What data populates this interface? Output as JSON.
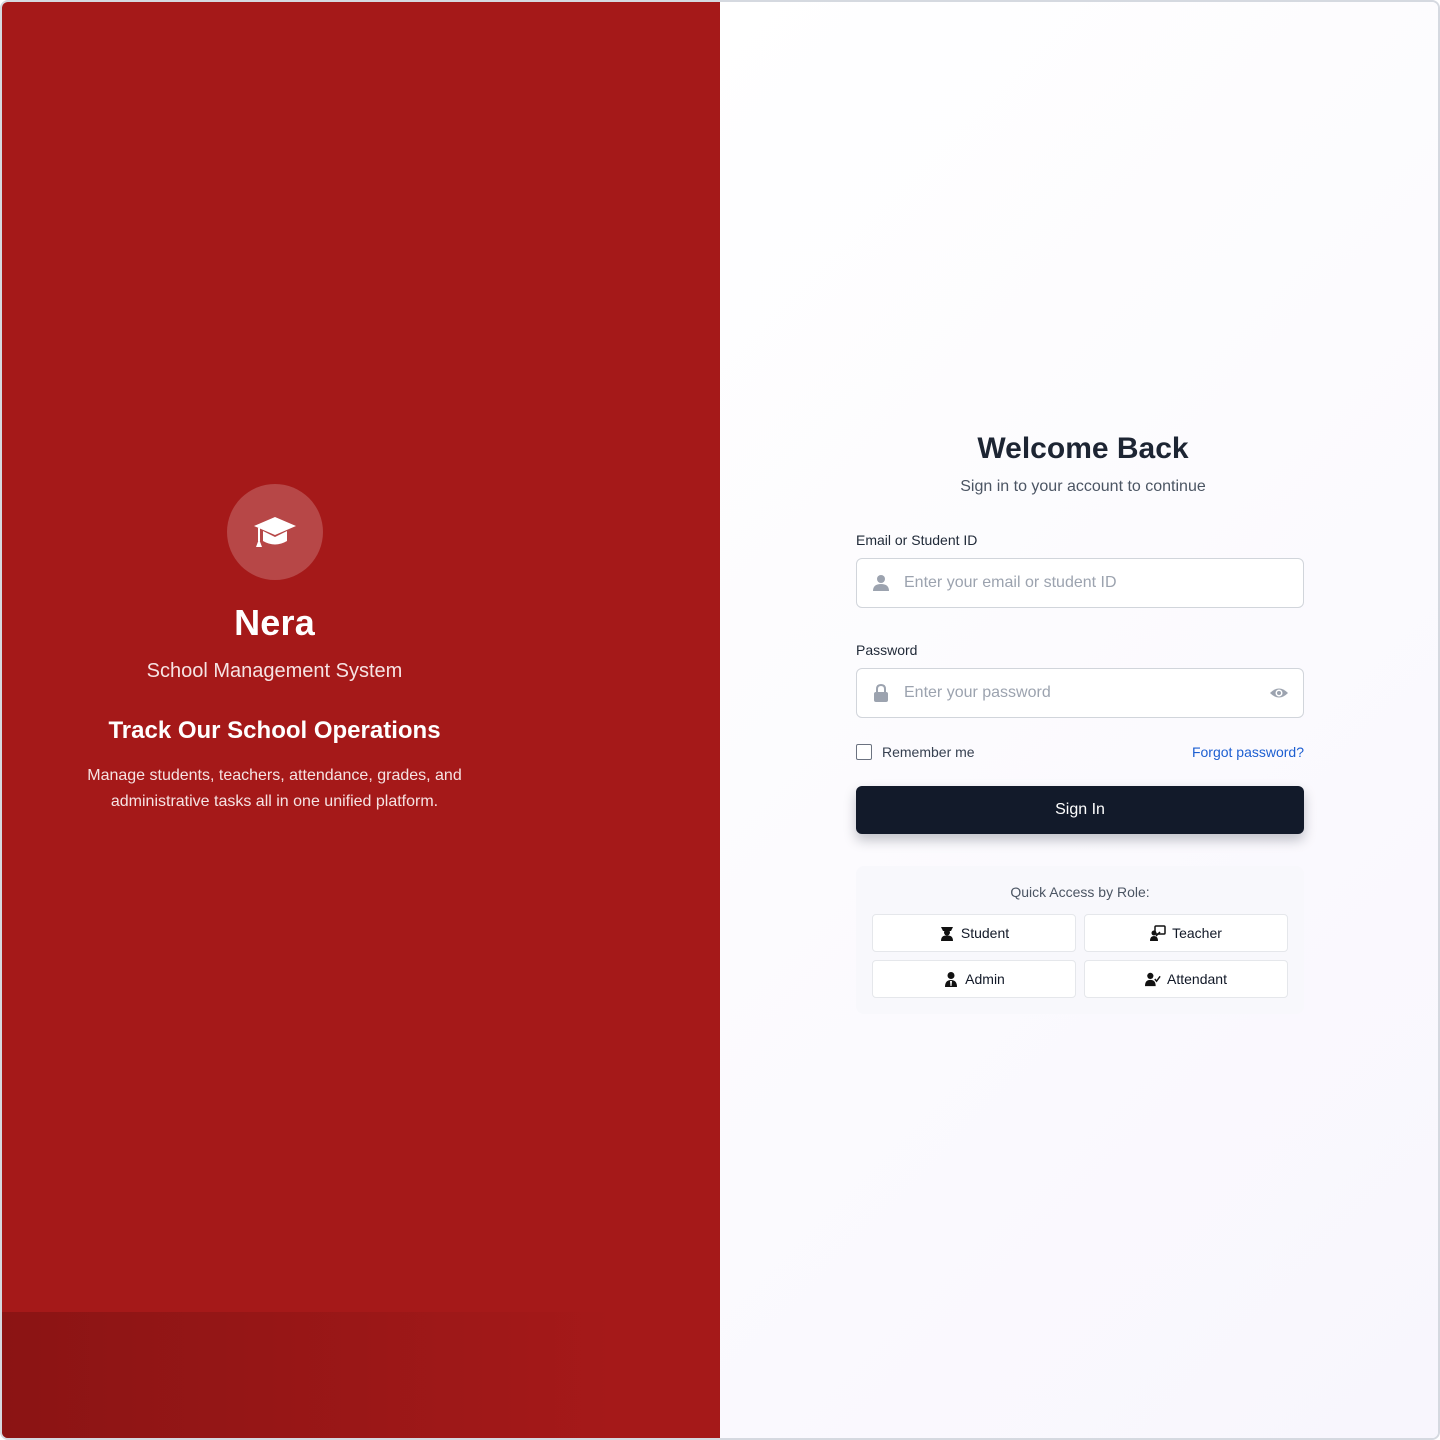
{
  "brand": {
    "name": "Nera",
    "subtitle": "School Management System",
    "heading": "Track Our School Operations",
    "description": "Manage students, teachers, attendance, grades, and administrative tasks all in one unified platform.",
    "logo_icon": "graduation-cap-icon"
  },
  "login": {
    "title": "Welcome Back",
    "subtitle": "Sign in to your account to continue",
    "email_label": "Email or Student ID",
    "email_placeholder": "Enter your email or student ID",
    "email_value": "",
    "password_label": "Password",
    "password_placeholder": "Enter your password",
    "password_value": "",
    "remember_label": "Remember me",
    "remember_checked": false,
    "forgot_label": "Forgot password?",
    "signin_label": "Sign In"
  },
  "quick_access": {
    "title": "Quick Access by Role:",
    "roles": [
      {
        "label": "Student",
        "icon": "student-icon"
      },
      {
        "label": "Teacher",
        "icon": "teacher-icon"
      },
      {
        "label": "Admin",
        "icon": "admin-icon"
      },
      {
        "label": "Attendant",
        "icon": "attendant-icon"
      }
    ]
  },
  "colors": {
    "brand_red": "#a51919",
    "button_dark": "#121a2a",
    "link_blue": "#1d5fd1"
  }
}
